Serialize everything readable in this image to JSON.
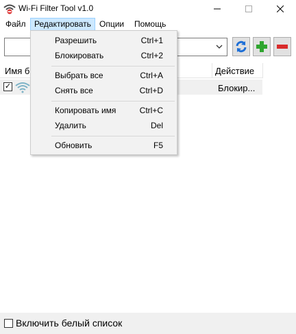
{
  "window": {
    "title": "Wi-Fi Filter Tool v1.0",
    "icon": "wifi-filter-app-icon"
  },
  "menubar": {
    "items": [
      {
        "label": "Файл"
      },
      {
        "label": "Редактировать"
      },
      {
        "label": "Опции"
      },
      {
        "label": "Помощь"
      }
    ]
  },
  "toolbar": {
    "combo_value": "",
    "buttons": [
      {
        "icon": "refresh-icon",
        "color": "#1e6fd6"
      },
      {
        "icon": "plus-icon",
        "color": "#2fa52f"
      },
      {
        "icon": "minus-icon",
        "color": "#d92b2b"
      }
    ]
  },
  "list": {
    "columns": [
      "Имя б",
      "Действие"
    ],
    "rows": [
      {
        "checked": true,
        "icon": "wifi-signal-icon",
        "name": "",
        "action": "Блокир..."
      }
    ]
  },
  "edit_menu": {
    "items": [
      {
        "label": "Разрешить",
        "shortcut": "Ctrl+1"
      },
      {
        "label": "Блокировать",
        "shortcut": "Ctrl+2"
      },
      {
        "label": "Выбрать все",
        "shortcut": "Ctrl+A"
      },
      {
        "label": "Снять все",
        "shortcut": "Ctrl+D"
      },
      {
        "label": "Копировать имя",
        "shortcut": "Ctrl+C"
      },
      {
        "label": "Удалить",
        "shortcut": "Del"
      },
      {
        "label": "Обновить",
        "shortcut": "F5"
      }
    ]
  },
  "footer": {
    "whitelist_label": "Включить белый список",
    "whitelist_checked": false
  }
}
